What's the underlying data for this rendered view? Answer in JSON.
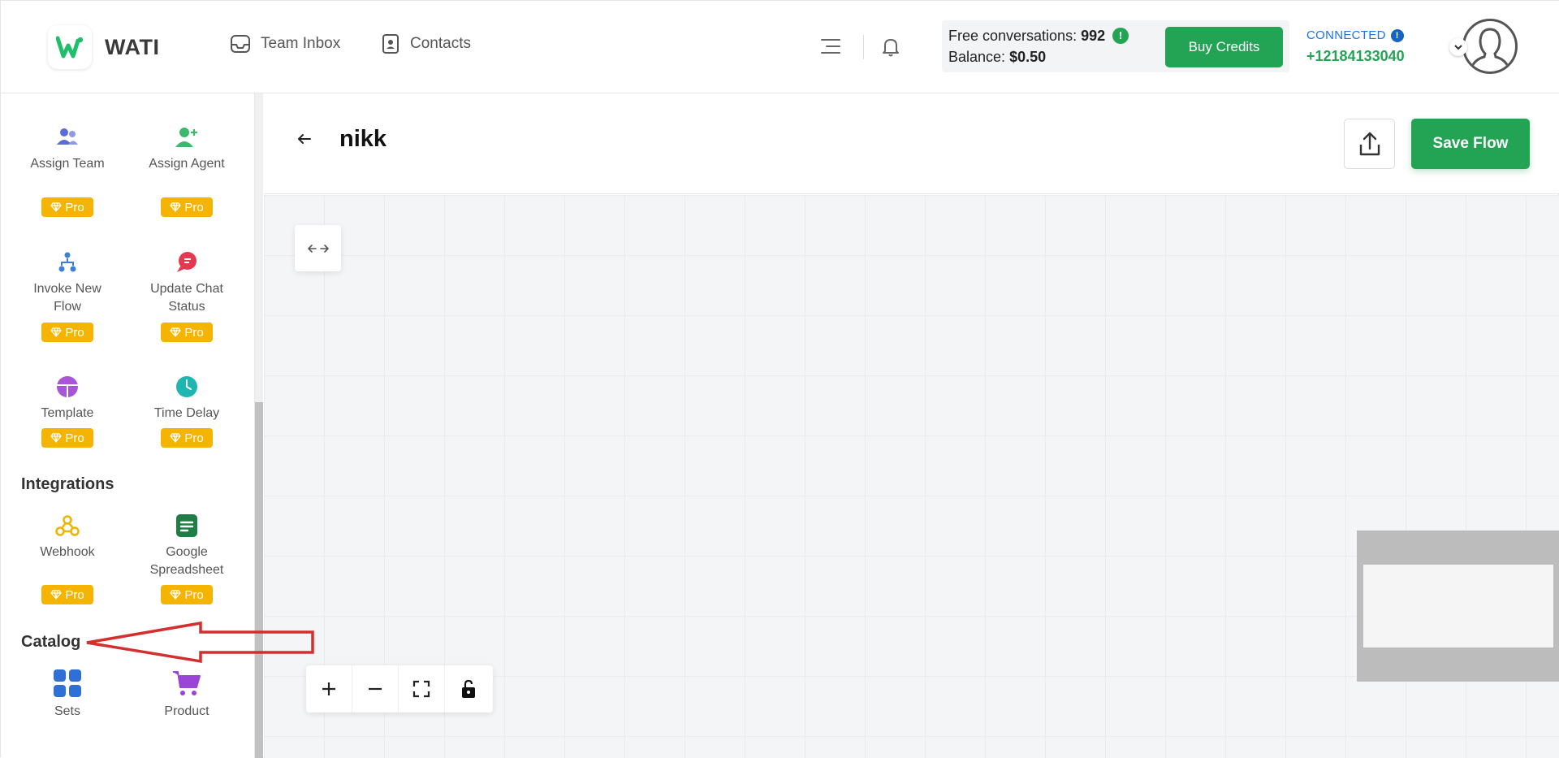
{
  "header": {
    "brand": "WATI",
    "nav": [
      {
        "label": "Team Inbox",
        "icon": "inbox-icon"
      },
      {
        "label": "Contacts",
        "icon": "contacts-icon"
      }
    ],
    "credits": {
      "free_label": "Free conversations:",
      "free_value": "992",
      "free_info": "!",
      "balance_label": "Balance:",
      "balance_value": "$0.50"
    },
    "buy_credits": "Buy Credits",
    "connection": {
      "status": "CONNECTED",
      "info": "!",
      "phone": "+12184133040"
    }
  },
  "sidebar": {
    "blocks_top": [
      {
        "label": "Assign Team",
        "icon": "assign-team-icon",
        "badge": "Pro"
      },
      {
        "label": "Assign Agent",
        "icon": "assign-agent-icon",
        "badge": "Pro"
      },
      {
        "label": "Invoke New Flow",
        "icon": "invoke-flow-icon",
        "badge": "Pro"
      },
      {
        "label": "Update Chat Status",
        "icon": "chat-status-icon",
        "badge": "Pro"
      },
      {
        "label": "Template",
        "icon": "template-icon",
        "badge": "Pro"
      },
      {
        "label": "Time Delay",
        "icon": "clock-icon",
        "badge": "Pro"
      }
    ],
    "integrations_title": "Integrations",
    "integrations": [
      {
        "label": "Webhook",
        "icon": "webhook-icon",
        "badge": "Pro"
      },
      {
        "label": "Google Spreadsheet",
        "icon": "spreadsheet-icon",
        "badge": "Pro"
      }
    ],
    "catalog_title": "Catalog",
    "catalog": [
      {
        "label": "Sets",
        "icon": "sets-icon"
      },
      {
        "label": "Product",
        "icon": "cart-icon"
      }
    ]
  },
  "flow": {
    "title": "nikk",
    "save_label": "Save Flow"
  },
  "colors": {
    "brand_green": "#23a455",
    "pro_badge": "#f4b400",
    "annotation_red": "#d32f2f"
  }
}
